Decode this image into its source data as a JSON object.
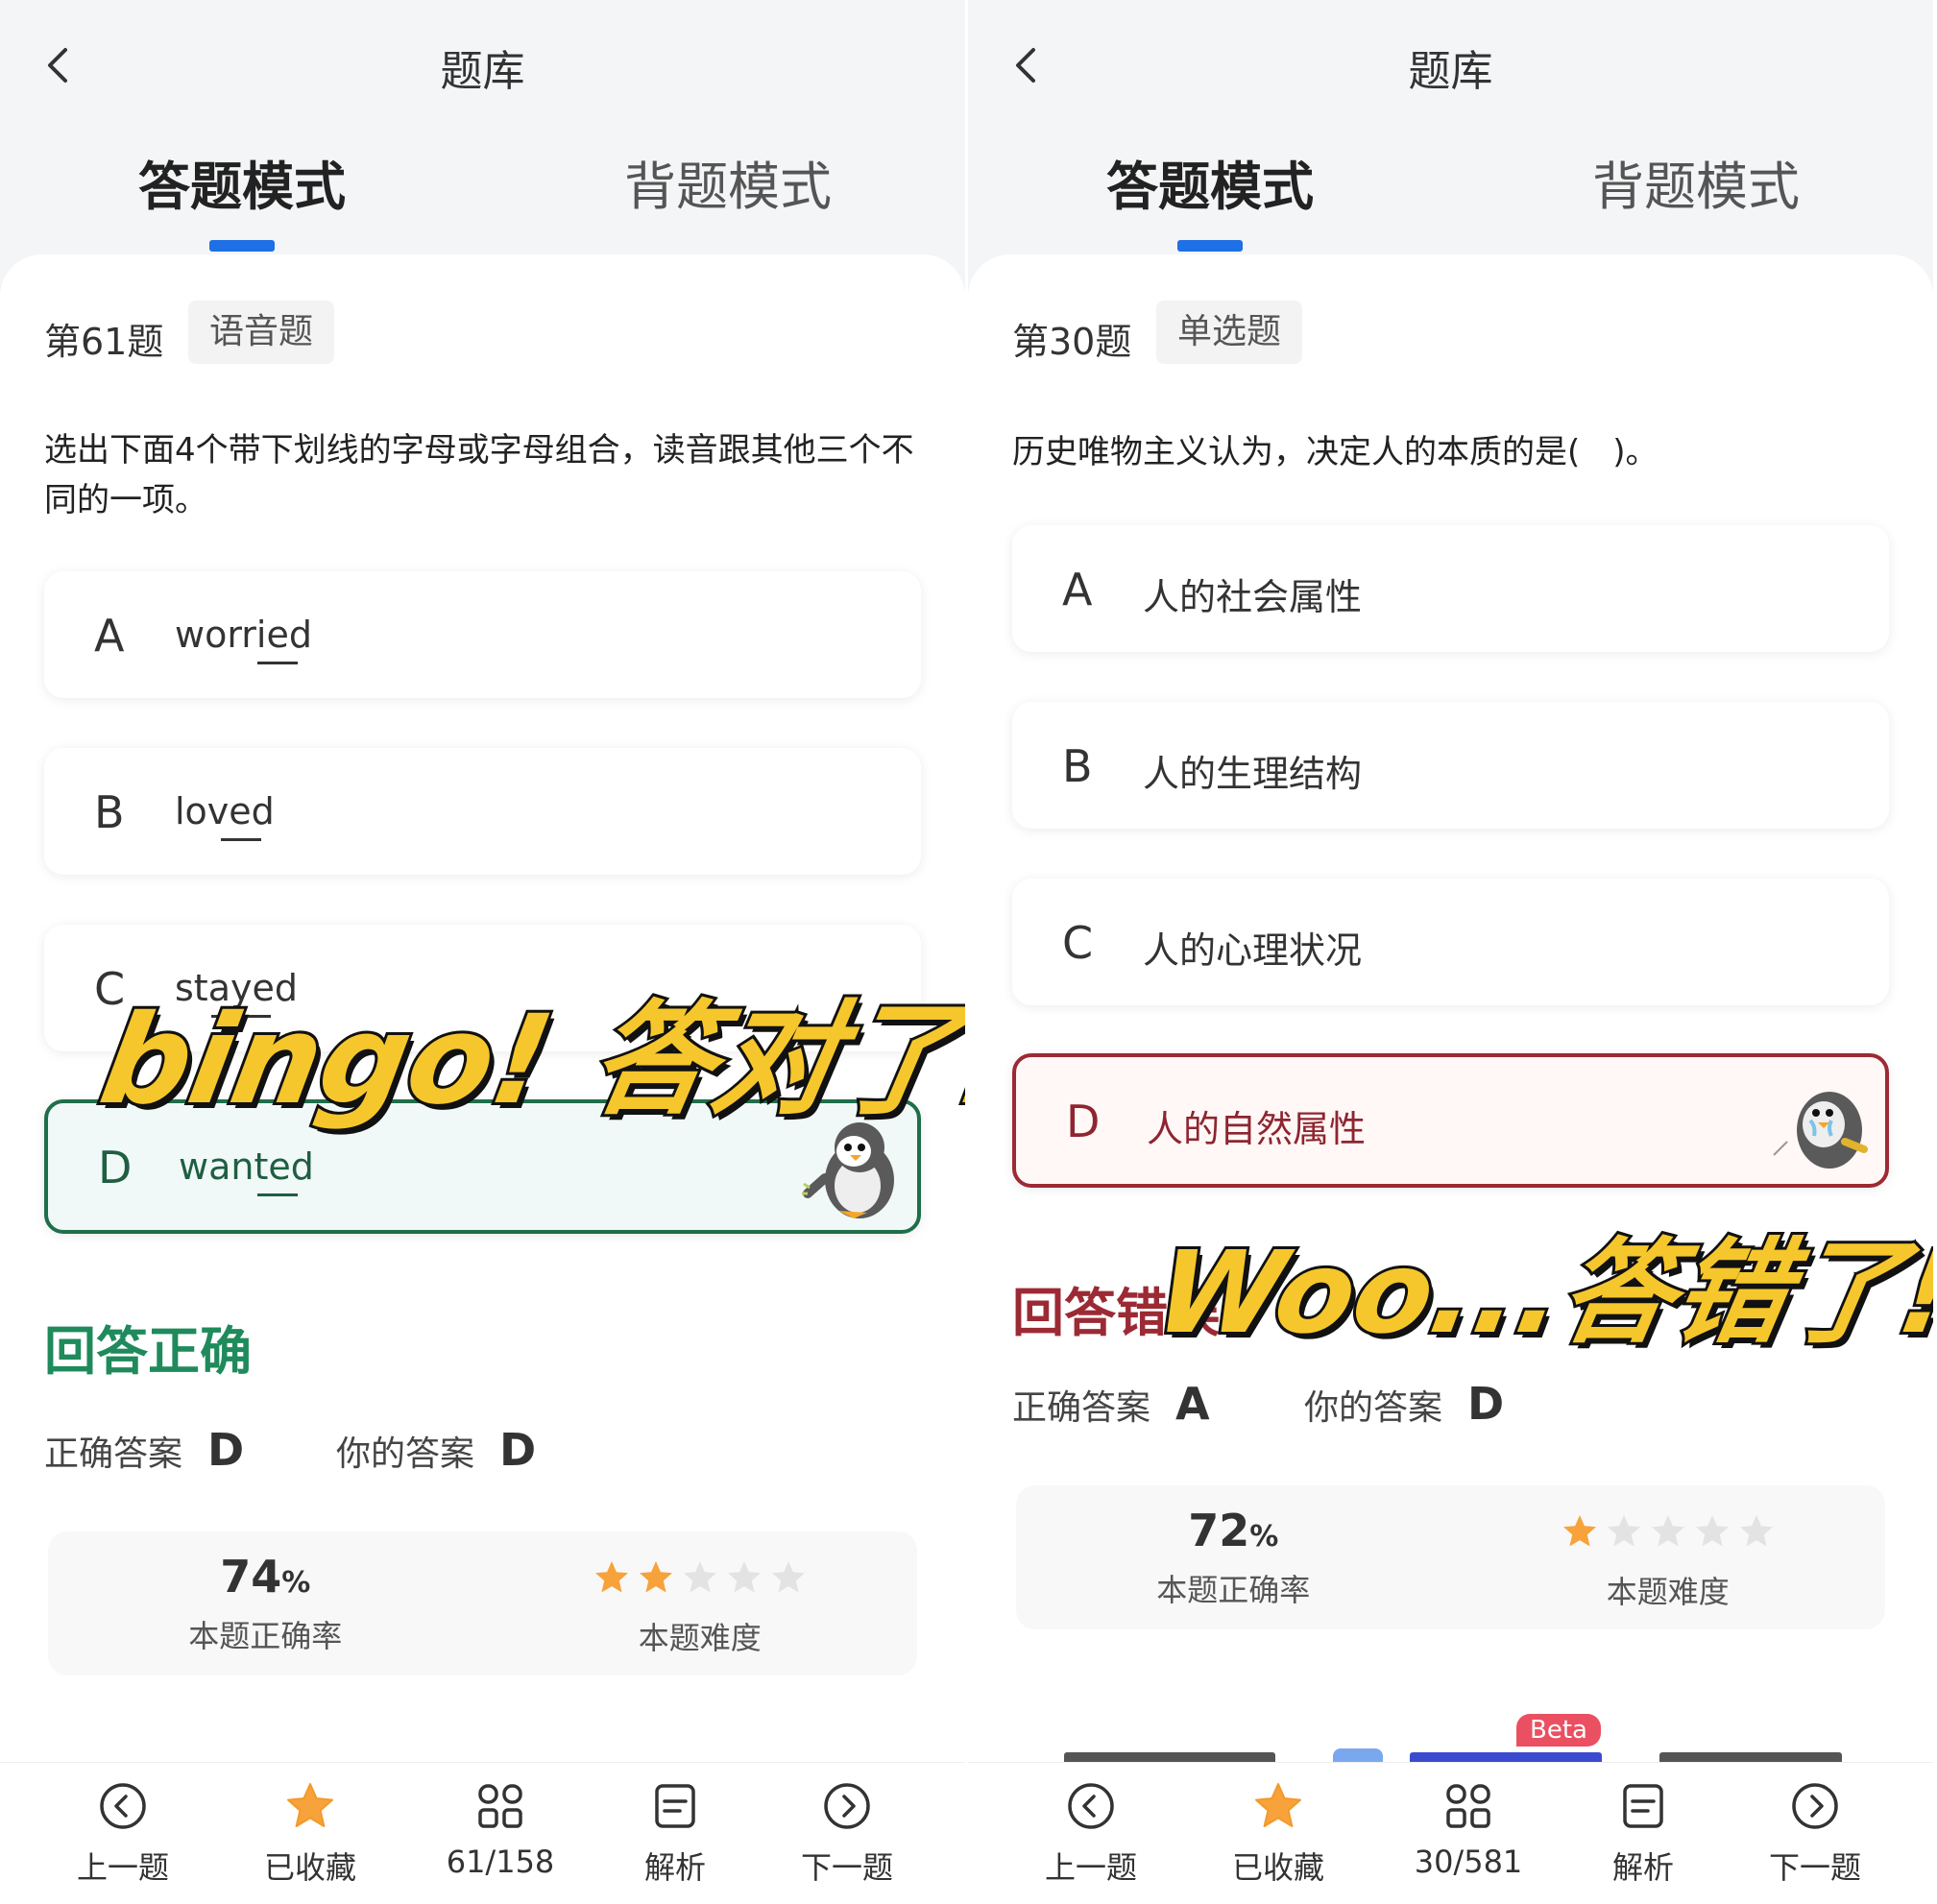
{
  "left": {
    "title": "题库",
    "tabs": [
      "答题模式",
      "背题模式"
    ],
    "question_number": "第61题",
    "question_type": "语音题",
    "question_text": "选出下面4个带下划线的字母或字母组合，读音跟其他三个不同的一项。",
    "options": [
      {
        "letter": "A",
        "text": "worried"
      },
      {
        "letter": "B",
        "text": "loved"
      },
      {
        "letter": "C",
        "text": "stayed"
      },
      {
        "letter": "D",
        "text": "wanted",
        "state": "correct"
      }
    ],
    "overlay_text": "bingo! 答对了!",
    "result_title": "回答正确",
    "correct_answer_label": "正确答案",
    "correct_answer": "D",
    "your_answer_label": "你的答案",
    "your_answer": "D",
    "accuracy_value": "74",
    "accuracy_unit": "%",
    "accuracy_label": "本题正确率",
    "difficulty_stars": 2,
    "difficulty_label": "本题难度",
    "bottom_nav": [
      "上一题",
      "已收藏",
      "61/158",
      "解析",
      "下一题"
    ]
  },
  "right": {
    "title": "题库",
    "tabs": [
      "答题模式",
      "背题模式"
    ],
    "question_number": "第30题",
    "question_type": "单选题",
    "question_text": "历史唯物主义认为，决定人的本质的是(　)。",
    "options": [
      {
        "letter": "A",
        "text": "人的社会属性"
      },
      {
        "letter": "B",
        "text": "人的生理结构"
      },
      {
        "letter": "C",
        "text": "人的心理状况"
      },
      {
        "letter": "D",
        "text": "人的自然属性",
        "state": "wrong"
      }
    ],
    "overlay_text": "Woo...答错了!",
    "result_title": "回答错误",
    "correct_answer_label": "正确答案",
    "correct_answer": "A",
    "your_answer_label": "你的答案",
    "your_answer": "D",
    "accuracy_value": "72",
    "accuracy_unit": "%",
    "accuracy_label": "本题正确率",
    "difficulty_stars": 1,
    "difficulty_label": "本题难度",
    "beta_badge": "Beta",
    "bottom_nav": [
      "上一题",
      "已收藏",
      "30/581",
      "解析",
      "下一题"
    ]
  },
  "colors": {
    "tab_indicator": "#1f6fe5",
    "correct": "#1f8a5b",
    "wrong": "#9c2a34",
    "star_on": "#f7a23a",
    "star_off": "#e3e3e3",
    "overlay_fill": "#f6c72c",
    "beta": "#ea5061"
  },
  "icons": {
    "back": "chevron-left-icon",
    "prev": "circle-arrow-left-icon",
    "fav": "star-filled-icon",
    "grid": "grid-icon",
    "analysis": "document-icon",
    "next": "circle-arrow-right-icon"
  }
}
